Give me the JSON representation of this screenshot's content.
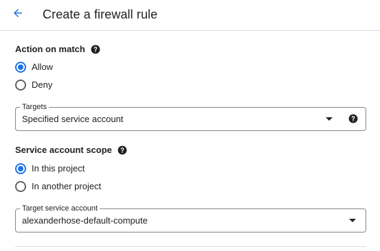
{
  "header": {
    "back_icon": "arrow-back-icon",
    "title": "Create a firewall rule"
  },
  "action_on_match": {
    "label": "Action on match",
    "help_icon": "help-icon",
    "options": [
      {
        "label": "Allow",
        "selected": true
      },
      {
        "label": "Deny",
        "selected": false
      }
    ]
  },
  "targets": {
    "legend": "Targets",
    "value": "Specified service account",
    "dropdown_icon": "arrow-drop-down-icon",
    "help_icon": "help-icon"
  },
  "service_account_scope": {
    "label": "Service account scope",
    "help_icon": "help-icon",
    "options": [
      {
        "label": "In this project",
        "selected": true
      },
      {
        "label": "In another project",
        "selected": false
      }
    ]
  },
  "target_service_account": {
    "legend": "Target service account",
    "value": "alexanderhose-default-compute",
    "dropdown_icon": "arrow-drop-down-icon"
  },
  "colors": {
    "accent": "#1a73e8",
    "text": "#202124",
    "border": "#80868b",
    "divider": "#dadce0"
  }
}
